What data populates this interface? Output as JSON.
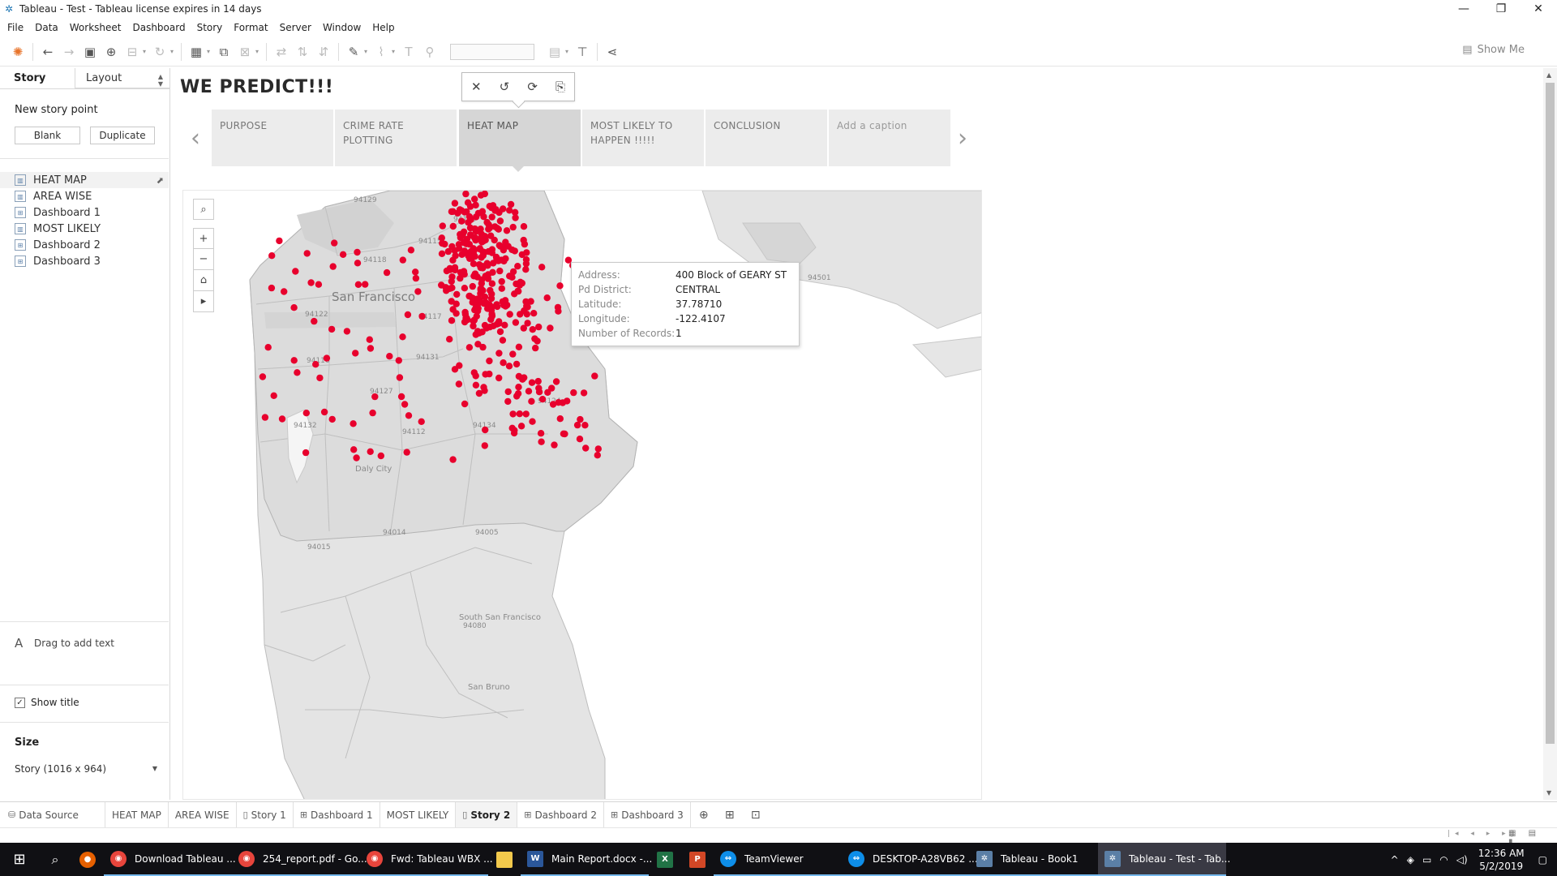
{
  "window": {
    "title": "Tableau - Test - Tableau license expires in 14 days",
    "controls": [
      "—",
      "❐",
      "✕"
    ]
  },
  "menu": [
    "File",
    "Data",
    "Worksheet",
    "Dashboard",
    "Story",
    "Format",
    "Server",
    "Window",
    "Help"
  ],
  "toolbar": {
    "show_me": "Show Me"
  },
  "left_pane": {
    "tab_story": "Story",
    "tab_layout": "Layout",
    "new_story_point": "New story point",
    "blank_button": "Blank",
    "duplicate_button": "Duplicate",
    "sheets": [
      {
        "label": "HEAT MAP",
        "active": true
      },
      {
        "label": "AREA WISE",
        "active": false
      },
      {
        "label": "Dashboard 1",
        "active": false
      },
      {
        "label": "MOST LIKELY",
        "active": false
      },
      {
        "label": "Dashboard 2",
        "active": false
      },
      {
        "label": "Dashboard 3",
        "active": false
      }
    ],
    "drag_text": "Drag to add text",
    "show_title": "Show title",
    "size_label": "Size",
    "size_value": "Story (1016 x 964)"
  },
  "story": {
    "title": "WE PREDICT!!!",
    "points": [
      {
        "label": "PURPOSE"
      },
      {
        "label": "CRIME RATE PLOTTING"
      },
      {
        "label": "HEAT MAP",
        "active": true
      },
      {
        "label": "MOST LIKELY TO HAPPEN !!!!!"
      },
      {
        "label": "CONCLUSION"
      },
      {
        "label": "Add a caption"
      }
    ]
  },
  "map": {
    "place_labels": [
      "San Francisco",
      "Daly City",
      "South San Francisco",
      "San Bruno"
    ],
    "zip_labels": [
      "94129",
      "94118",
      "94115",
      "94109",
      "94122",
      "94117",
      "94116",
      "94131",
      "94127",
      "94132",
      "94112",
      "94134",
      "94124",
      "94014",
      "94005",
      "94015",
      "94080",
      "94501"
    ],
    "marker_color": "#e8002d",
    "tooltip": [
      {
        "key": "Address:",
        "value": "400 Block of GEARY ST"
      },
      {
        "key": "Pd District:",
        "value": "CENTRAL"
      },
      {
        "key": "Latitude:",
        "value": "37.78710"
      },
      {
        "key": "Longitude:",
        "value": "-122.4107"
      },
      {
        "key": "Number of Records:",
        "value": "1"
      }
    ]
  },
  "sheet_tabs": [
    {
      "label": "Data Source",
      "icon": "data-source-icon",
      "active": false
    },
    {
      "label": "HEAT MAP",
      "active": false
    },
    {
      "label": "AREA WISE",
      "active": false
    },
    {
      "label": "Story 1",
      "icon": "story-icon",
      "active": false
    },
    {
      "label": "Dashboard 1",
      "icon": "dashboard-icon",
      "active": false
    },
    {
      "label": "MOST LIKELY",
      "active": false
    },
    {
      "label": "Story 2",
      "icon": "story-icon",
      "active": true
    },
    {
      "label": "Dashboard 2",
      "icon": "dashboard-icon",
      "active": false
    },
    {
      "label": "Dashboard 3",
      "icon": "dashboard-icon",
      "active": false
    }
  ],
  "taskbar": {
    "apps": [
      {
        "label": "Download Tableau ...",
        "icon": "chrome-icon",
        "color": "#e8453c"
      },
      {
        "label": "254_report.pdf - Go...",
        "icon": "chrome-icon",
        "color": "#e8453c"
      },
      {
        "label": "Fwd: Tableau WBX ...",
        "icon": "chrome-icon",
        "color": "#e8453c"
      },
      {
        "label": "Main Report.docx -...",
        "icon": "word-icon",
        "color": "#2b579a"
      },
      {
        "label": "TeamViewer",
        "icon": "teamviewer-icon",
        "color": "#0e8ee9"
      },
      {
        "label": "DESKTOP-A28VB62 ...",
        "icon": "teamviewer-icon",
        "color": "#0e8ee9"
      },
      {
        "label": "Tableau - Book1",
        "icon": "tableau-icon",
        "color": "#5b7fa6"
      },
      {
        "label": "Tableau - Test - Tab...",
        "icon": "tableau-icon",
        "color": "#5b7fa6",
        "active": true
      }
    ],
    "time": "12:36 AM",
    "date": "5/2/2019"
  }
}
